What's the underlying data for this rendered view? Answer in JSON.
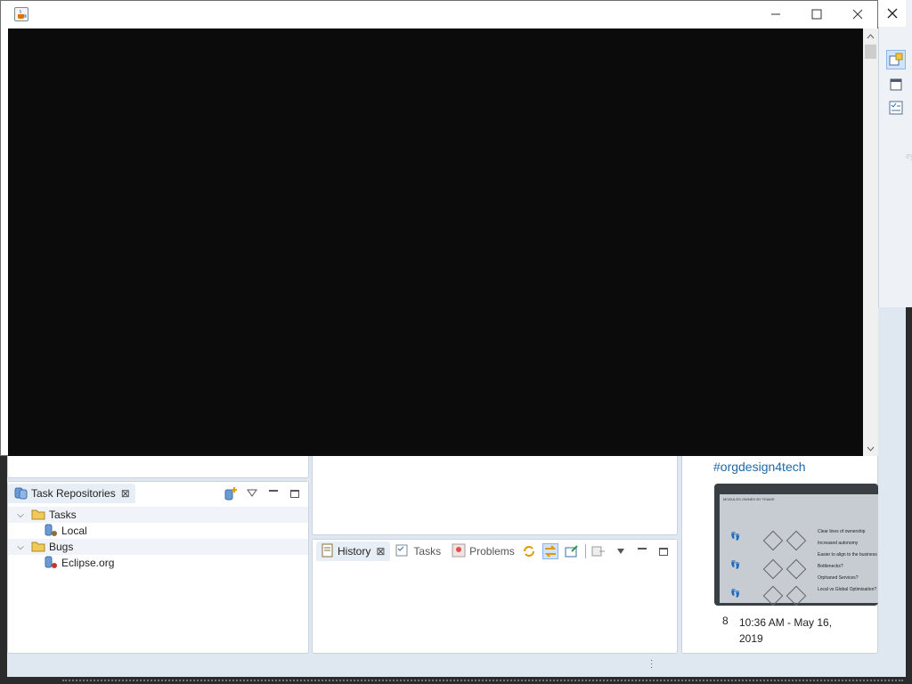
{
  "java_window": {
    "title": "",
    "icon": "java-cup-icon",
    "controls": {
      "minimize": "—",
      "maximize": "☐",
      "close": "✕"
    }
  },
  "outer_window": {
    "close": "✕"
  },
  "perspective_bar": {
    "icons": [
      "open-perspective-icon",
      "default-perspective-icon",
      "task-perspective-icon"
    ]
  },
  "task_repositories": {
    "tab_label": "Task Repositories",
    "icon": "task-repository-icon",
    "tree": [
      {
        "label": "Tasks",
        "expanded": true,
        "children": [
          {
            "label": "Local"
          }
        ]
      },
      {
        "label": "Bugs",
        "expanded": true,
        "children": [
          {
            "label": "Eclipse.org"
          }
        ]
      }
    ]
  },
  "bottom_views": {
    "tabs": [
      {
        "label": "History",
        "active": true
      },
      {
        "label": "Tasks",
        "active": false
      },
      {
        "label": "Problems",
        "active": false
      }
    ]
  },
  "tweet": {
    "hashtag": "#orgdesign4tech",
    "slide": {
      "heading": "MODULES OWNED BY TEAMS",
      "bullets": [
        "Clear lines of ownership",
        "Increased autonomy",
        "Easier to align to the business",
        "Bottlenecks?",
        "Orphaned Services?",
        "Local vs Global Optimisation?"
      ]
    },
    "count": "8",
    "timestamp": "10:36 AM - May 16, 2019"
  },
  "colors": {
    "ide_background": "#dfe7f1",
    "java_canvas": "#0b0b0b",
    "link": "#1a6aab",
    "selection": "#cfe3fb"
  }
}
